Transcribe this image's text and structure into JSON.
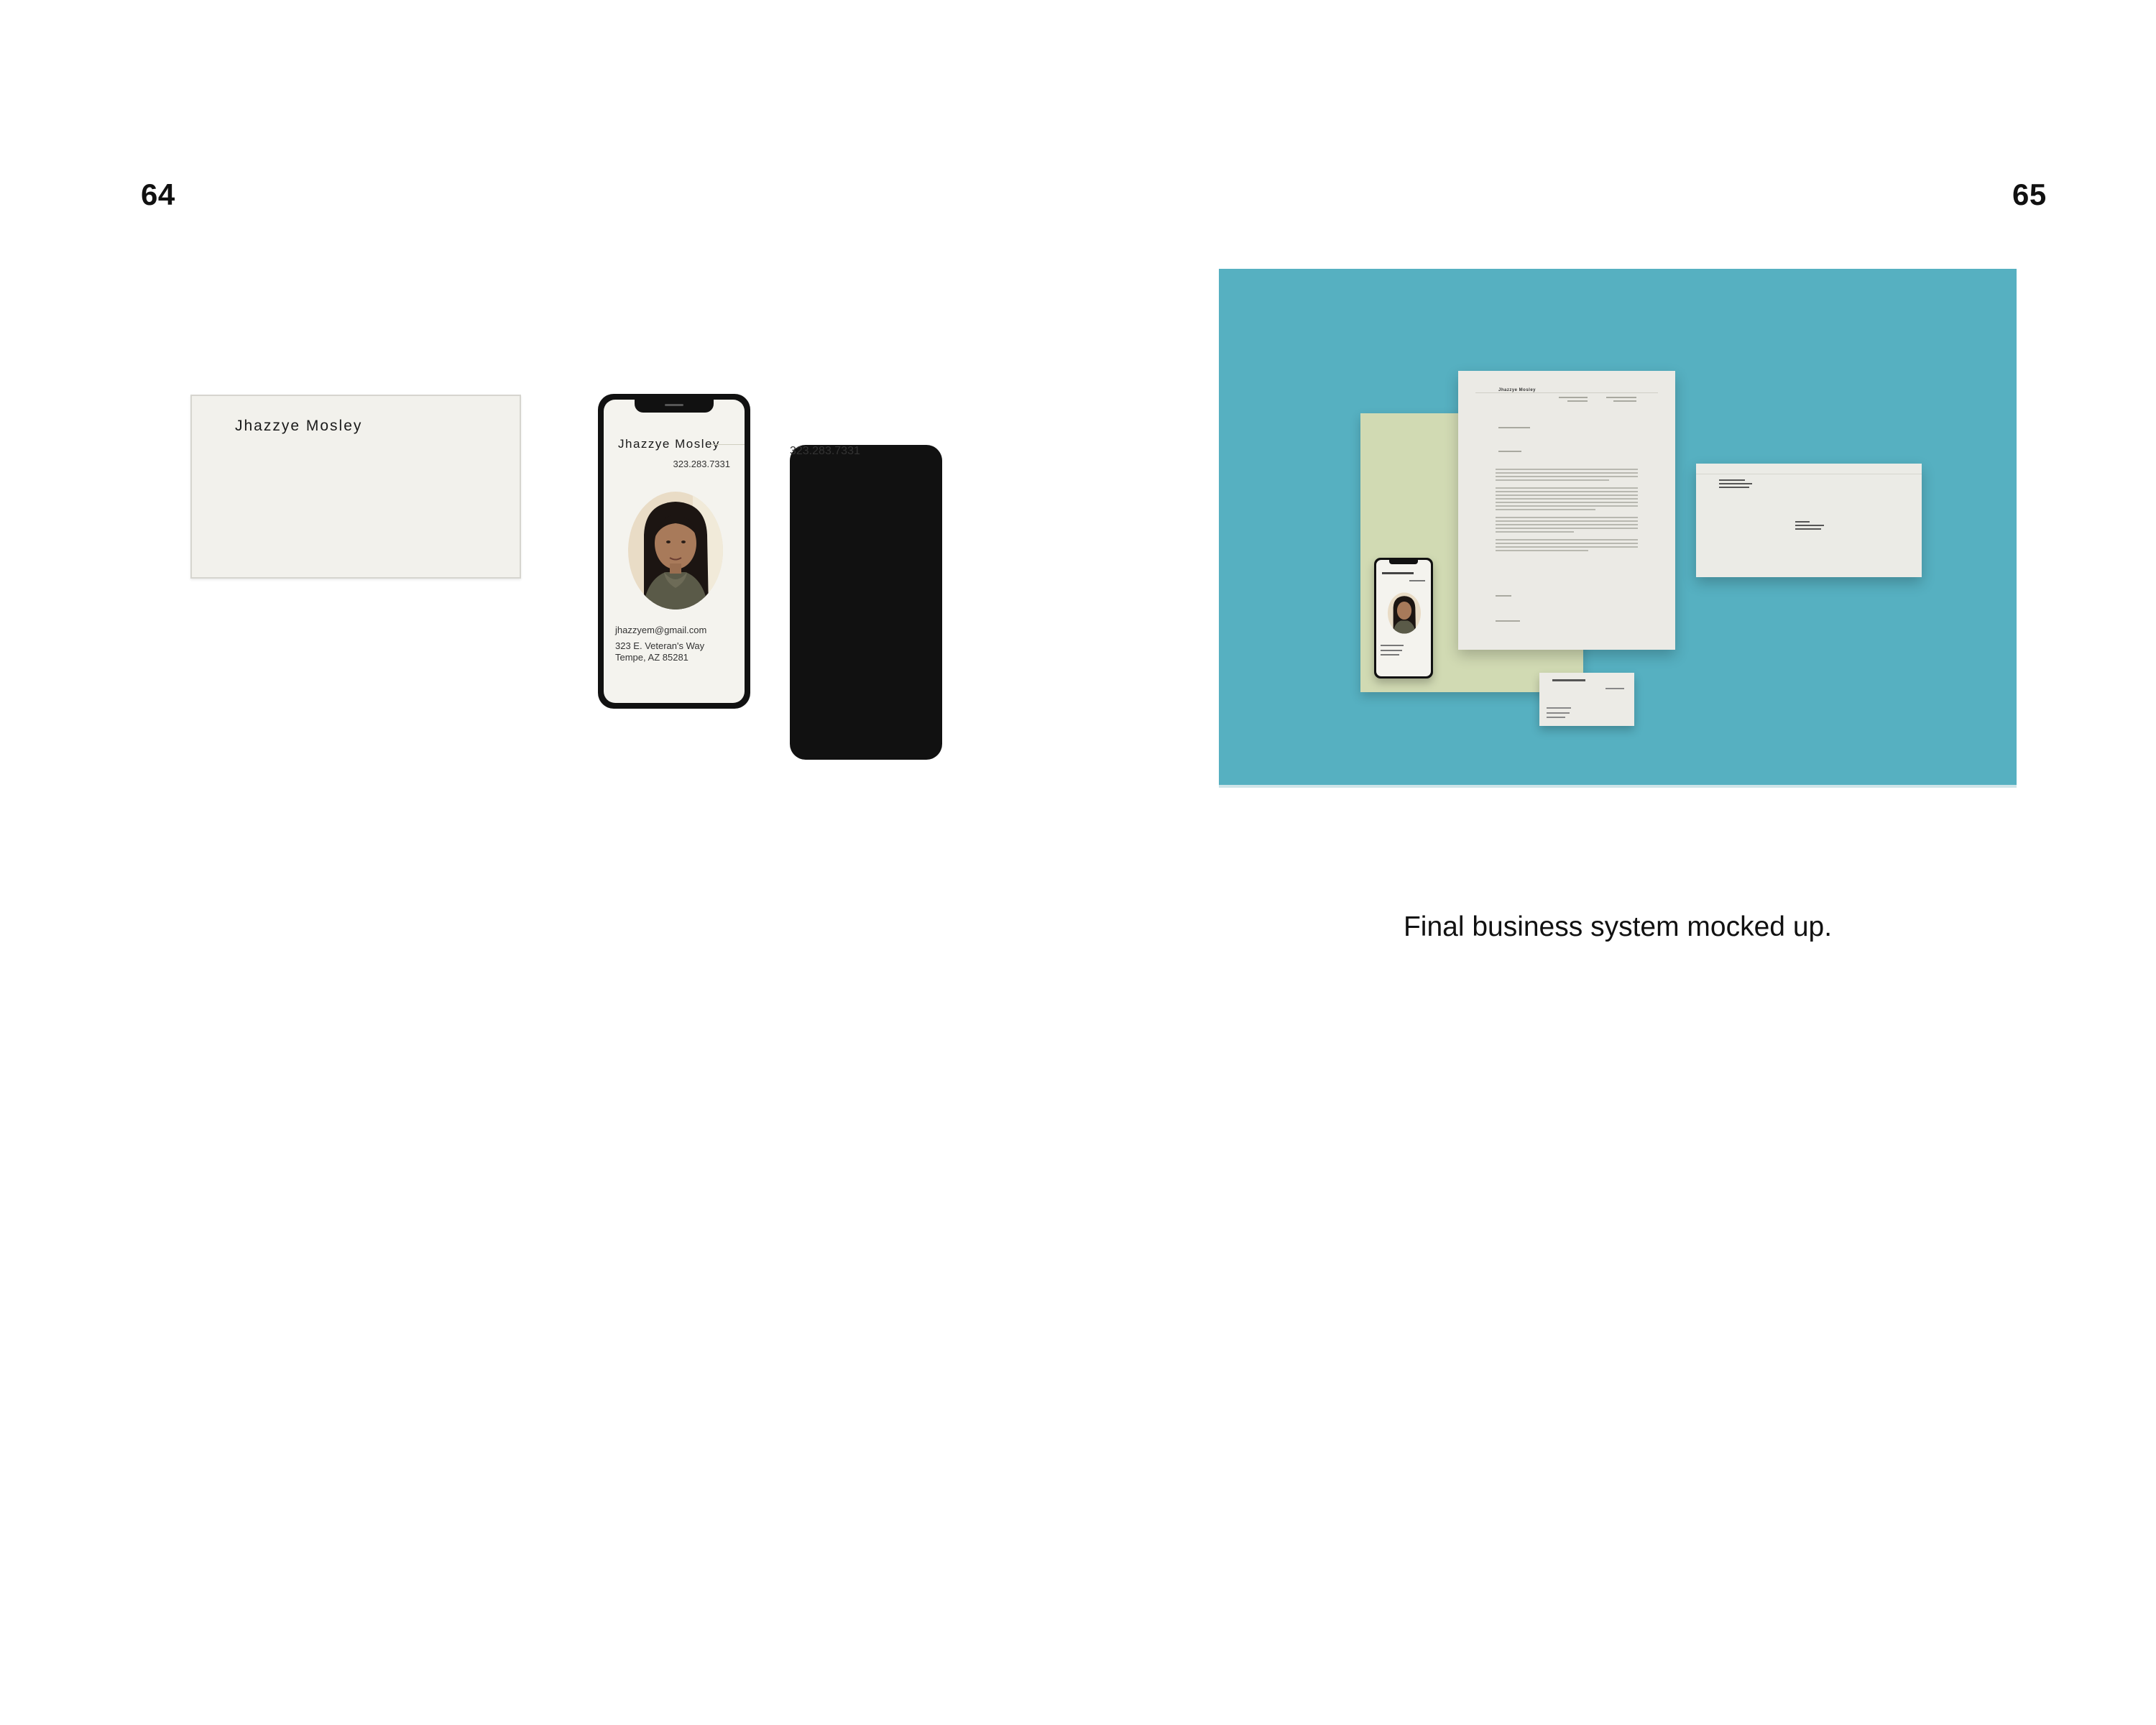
{
  "pages": {
    "left_number": "64",
    "right_number": "65"
  },
  "business_card": {
    "name": "Jhazzye Mosley",
    "phone": "323.283.7331"
  },
  "phone_card": {
    "name": "Jhazzye Mosley",
    "phone": "323.283.7331",
    "email": "jhazzyem@gmail.com",
    "address_line1": "323 E. Veteran's Way",
    "address_line2": "Tempe, AZ 85281"
  },
  "mockup": {
    "background_color": "#56b0c1",
    "backing_color": "#d1dab3",
    "letterhead_name": "Jhazzye Mosley"
  },
  "caption": "Final business system mocked up."
}
